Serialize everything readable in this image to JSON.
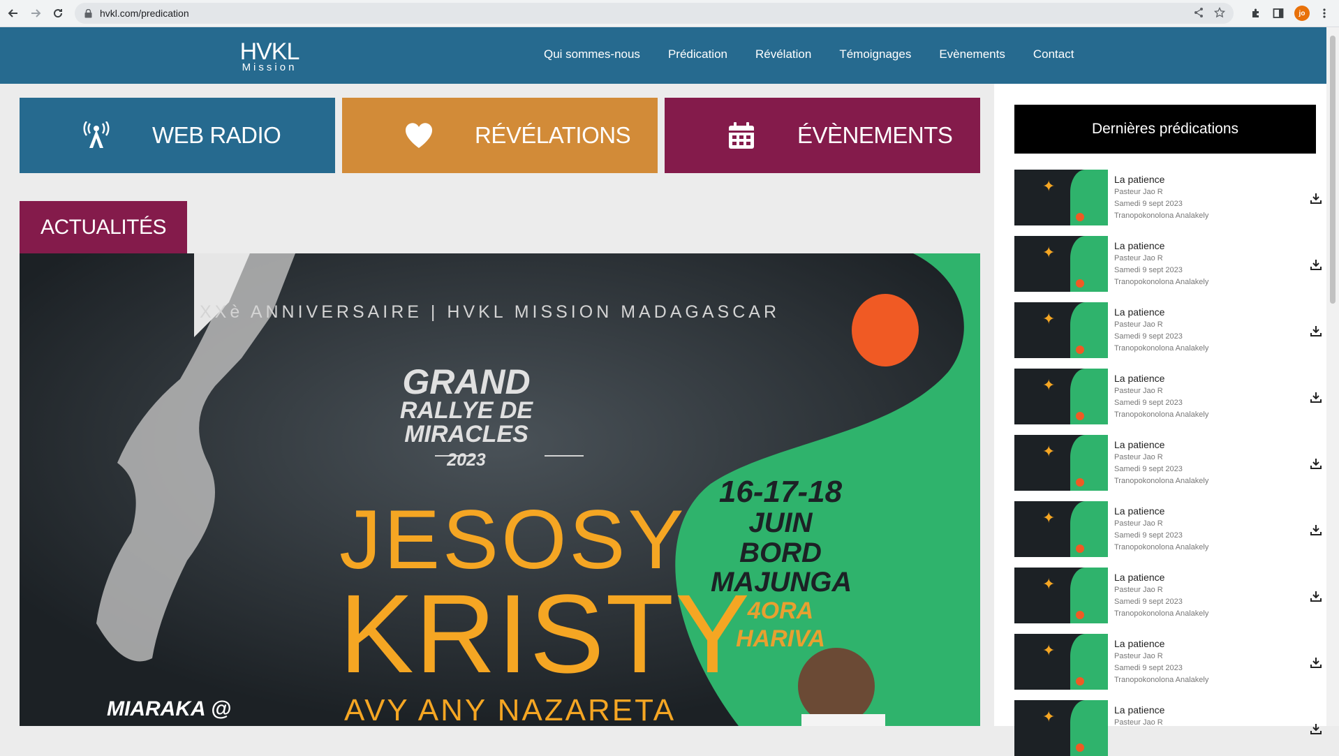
{
  "browser": {
    "url": "hvkl.com/predication",
    "profile_initials": "jo"
  },
  "site": {
    "logo_main": "HVKL",
    "logo_sub": "Mission",
    "nav": [
      "Qui sommes-nous",
      "Prédication",
      "Révélation",
      "Témoignages",
      "Evènements",
      "Contact"
    ]
  },
  "tiles": {
    "radio": "WEB RADIO",
    "revelations": "RÉVÉLATIONS",
    "events": "ÉVÈNEMENTS"
  },
  "news": {
    "tab_label": "ACTUALITÉS",
    "poster": {
      "anniversary": "XXè ANNIVERSAIRE | HVKL MISSION MADAGASCAR",
      "grand": "GRAND",
      "rallye": "RALLYE DE",
      "miracles": "MIRACLES",
      "year": "2023",
      "title1": "JESOSY",
      "title2": "KRISTY",
      "title3": "AVY ANY NAZARETA",
      "dates": "16-17-18",
      "month": "JUIN",
      "bord": "BORD",
      "city": "MAJUNGA",
      "time": "4ORA HARIVA",
      "miaraka": "MIARAKA @"
    }
  },
  "sidebar": {
    "title": "Dernières prédications",
    "sermons": [
      {
        "title": "La patience",
        "speaker": "Pasteur Jao R",
        "date": "Samedi 9 sept 2023",
        "place": "Tranopokonolona Analakely"
      },
      {
        "title": "La patience",
        "speaker": "Pasteur Jao R",
        "date": "Samedi 9 sept 2023",
        "place": "Tranopokonolona Analakely"
      },
      {
        "title": "La patience",
        "speaker": "Pasteur Jao R",
        "date": "Samedi 9 sept 2023",
        "place": "Tranopokonolona Analakely"
      },
      {
        "title": "La patience",
        "speaker": "Pasteur Jao R",
        "date": "Samedi 9 sept 2023",
        "place": "Tranopokonolona Analakely"
      },
      {
        "title": "La patience",
        "speaker": "Pasteur Jao R",
        "date": "Samedi 9 sept 2023",
        "place": "Tranopokonolona Analakely"
      },
      {
        "title": "La patience",
        "speaker": "Pasteur Jao R",
        "date": "Samedi 9 sept 2023",
        "place": "Tranopokonolona Analakely"
      },
      {
        "title": "La patience",
        "speaker": "Pasteur Jao R",
        "date": "Samedi 9 sept 2023",
        "place": "Tranopokonolona Analakely"
      },
      {
        "title": "La patience",
        "speaker": "Pasteur Jao R",
        "date": "Samedi 9 sept 2023",
        "place": "Tranopokonolona Analakely"
      },
      {
        "title": "La patience",
        "speaker": "Pasteur Jao R",
        "date": "",
        "place": ""
      }
    ]
  },
  "colors": {
    "header_blue": "#266a8f",
    "orange": "#d28b38",
    "burgundy": "#841b4b"
  }
}
